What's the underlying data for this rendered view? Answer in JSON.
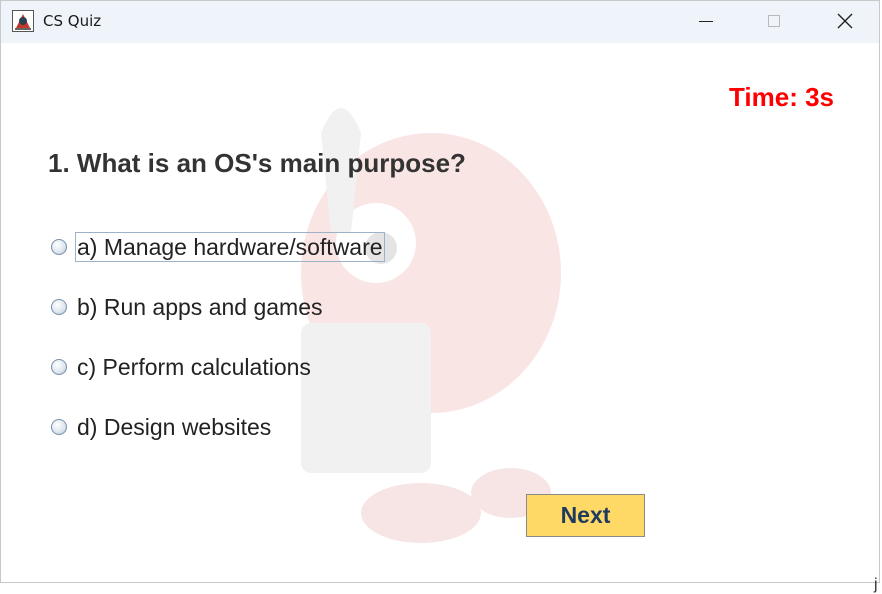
{
  "window": {
    "title": "CS Quiz",
    "app_icon": "java-duke-icon",
    "controls": [
      "minimize-icon",
      "maximize-icon",
      "close-icon"
    ]
  },
  "timer": {
    "text": "Time: 3s",
    "color": "#ff0000"
  },
  "question": {
    "text": "1. What is an OS's main purpose?"
  },
  "options": [
    {
      "label": "a) Manage hardware/software",
      "selected": false,
      "focused": true
    },
    {
      "label": "b) Run apps and games",
      "selected": false,
      "focused": false
    },
    {
      "label": "c) Perform calculations",
      "selected": false,
      "focused": false
    },
    {
      "label": "d) Design websites",
      "selected": false,
      "focused": false
    }
  ],
  "next_button": {
    "label": "Next",
    "background": "#ffd966",
    "color": "#1f3a5f"
  },
  "edge_glyph": "j",
  "watermark": {
    "icon": "brain-mascot-watermark"
  }
}
